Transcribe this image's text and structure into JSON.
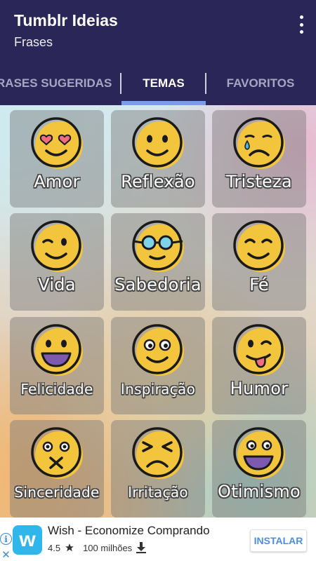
{
  "app": {
    "title": "Tumblr Ideias",
    "subtitle": "Frases"
  },
  "tabs": [
    {
      "label": "FRASES SUGERIDAS",
      "active": false
    },
    {
      "label": "TEMAS",
      "active": true
    },
    {
      "label": "FAVORITOS",
      "active": false
    }
  ],
  "themes": [
    {
      "label": "Amor",
      "icon": "heart-eyes-emoji-icon"
    },
    {
      "label": "Reflexão",
      "icon": "smile-emoji-icon"
    },
    {
      "label": "Tristeza",
      "icon": "crying-emoji-icon"
    },
    {
      "label": "Vida",
      "icon": "wink-emoji-icon"
    },
    {
      "label": "Sabedoria",
      "icon": "glasses-emoji-icon"
    },
    {
      "label": "Fé",
      "icon": "content-emoji-icon"
    },
    {
      "label": "Felicidade",
      "icon": "grin-emoji-icon"
    },
    {
      "label": "Inspiração",
      "icon": "wide-eyed-emoji-icon"
    },
    {
      "label": "Humor",
      "icon": "tongue-out-emoji-icon"
    },
    {
      "label": "Sinceridade",
      "icon": "sealed-mouth-emoji-icon"
    },
    {
      "label": "Irritação",
      "icon": "frustrated-emoji-icon"
    },
    {
      "label": "Otimismo",
      "icon": "excited-emoji-icon"
    }
  ],
  "ad": {
    "logo_letter": "w",
    "title": "Wish - Economize Comprando",
    "rating": "4.5",
    "downloads": "100 milhões",
    "install_label": "INSTALAR",
    "info_glyph": "i",
    "close_glyph": "✕"
  },
  "colors": {
    "appbar": "#2b2658",
    "indicator": "#7c9be8",
    "face": "#f2c53d",
    "ad_accent": "#2fb7ec"
  }
}
